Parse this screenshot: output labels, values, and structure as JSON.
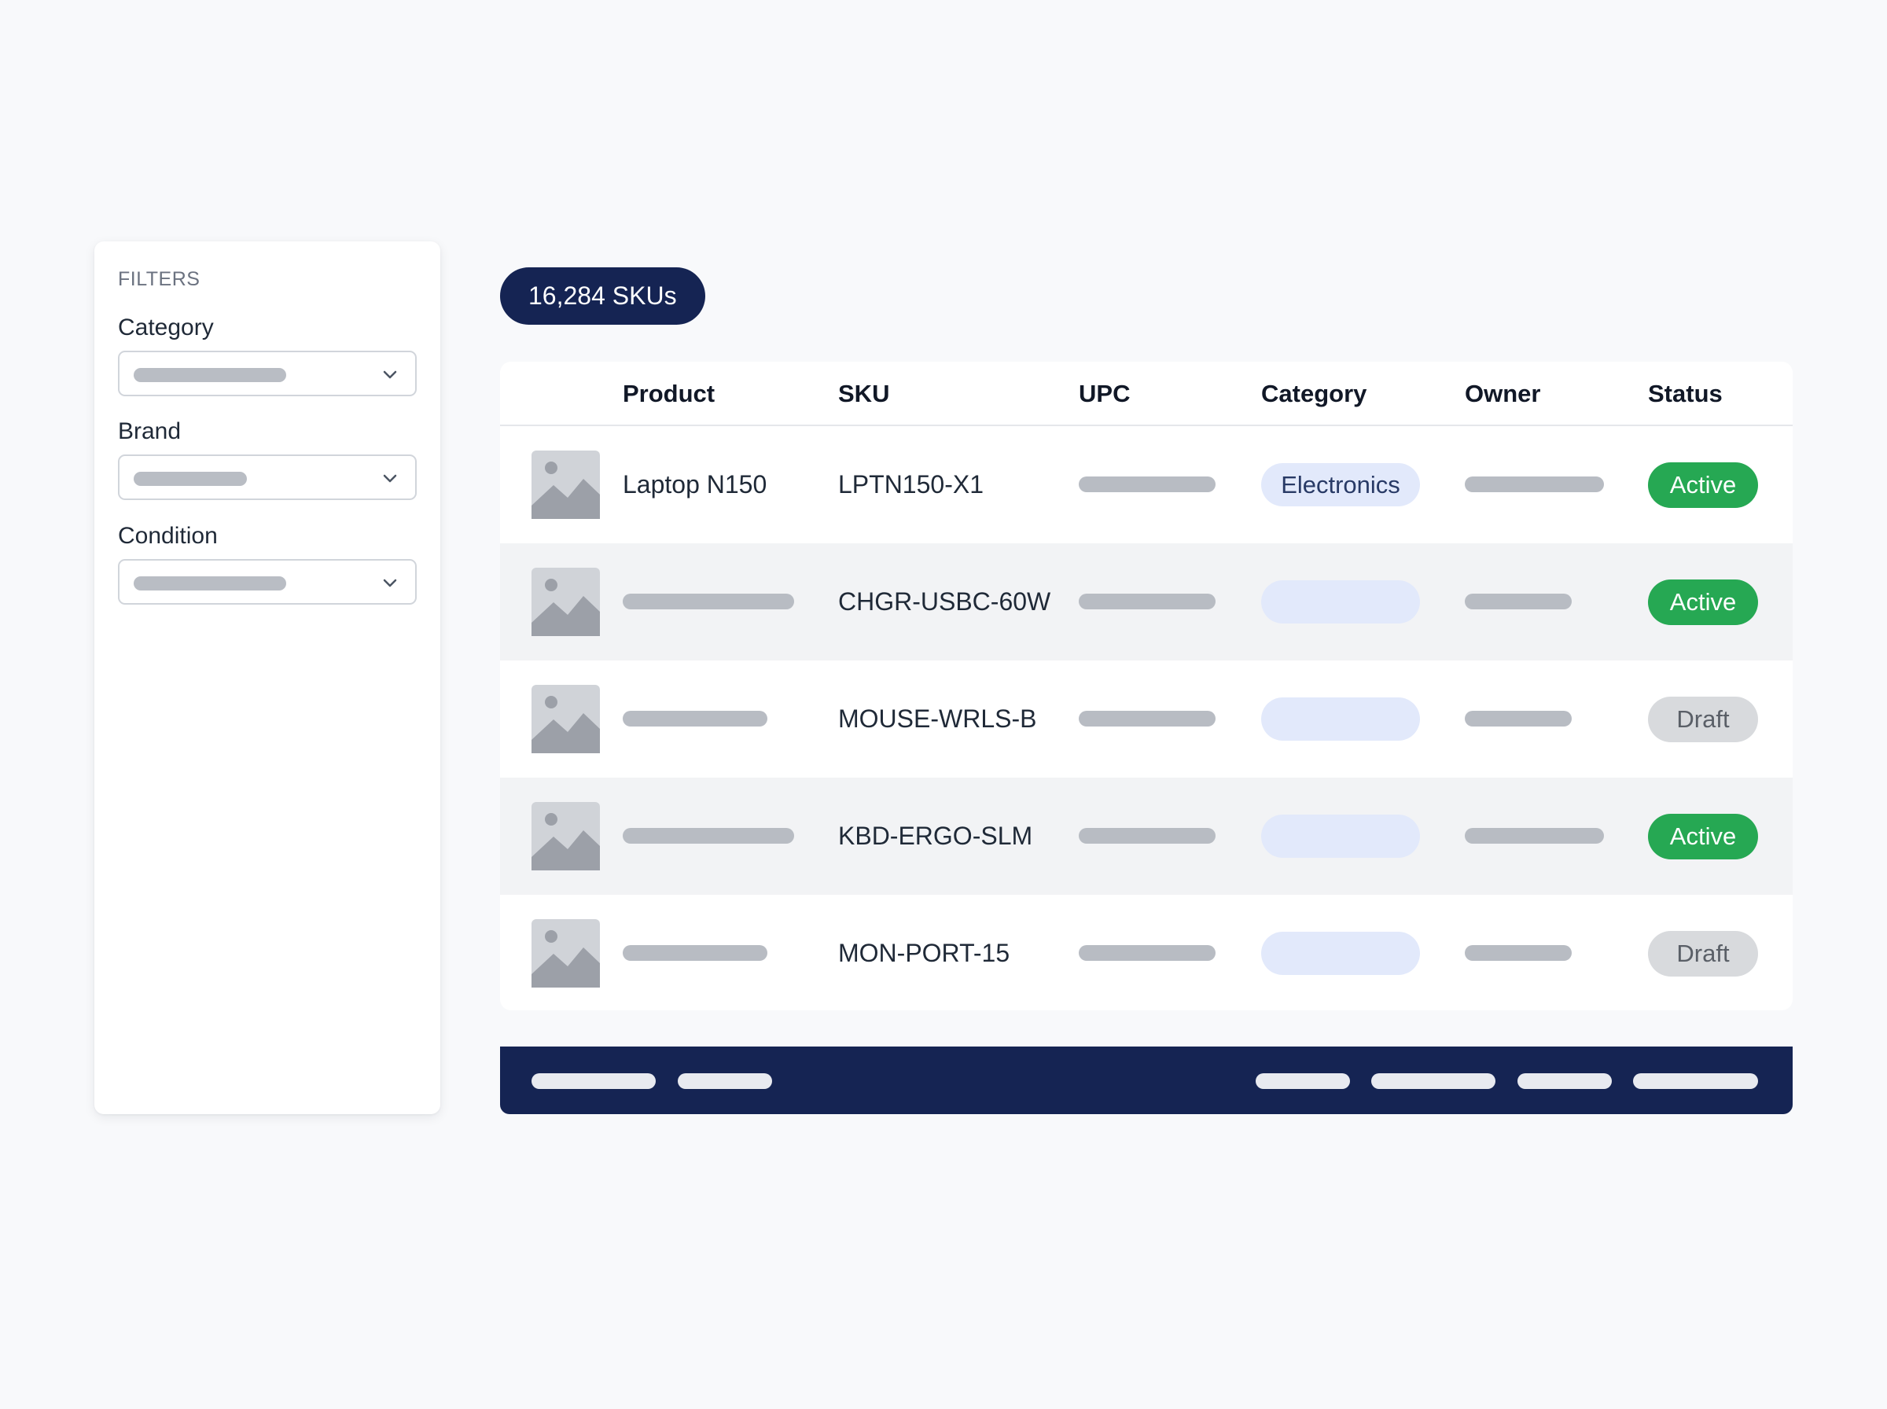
{
  "filters": {
    "title": "FILTERS",
    "groups": [
      {
        "label": "Category"
      },
      {
        "label": "Brand"
      },
      {
        "label": "Condition"
      }
    ]
  },
  "count_badge": "16,284 SKUs",
  "table": {
    "columns": [
      "Product",
      "SKU",
      "UPC",
      "Category",
      "Owner",
      "Status"
    ],
    "rows": [
      {
        "product": "Laptop N150",
        "sku": "LPTN150-X1",
        "category": "Electronics",
        "status": "Active"
      },
      {
        "product": "",
        "sku": "CHGR-USBC-60W",
        "category": "",
        "status": "Active"
      },
      {
        "product": "",
        "sku": "MOUSE-WRLS-B",
        "category": "",
        "status": "Draft"
      },
      {
        "product": "",
        "sku": "KBD-ERGO-SLM",
        "category": "",
        "status": "Active"
      },
      {
        "product": "",
        "sku": "MON-PORT-15",
        "category": "",
        "status": "Draft"
      }
    ]
  },
  "icons": {
    "thumbnail": "image-placeholder-icon",
    "dropdown": "chevron-down-icon"
  },
  "colors": {
    "navy": "#152453",
    "active": "#26a853",
    "draft": "#d8dadd",
    "category_pill": "#e2e9fb"
  }
}
